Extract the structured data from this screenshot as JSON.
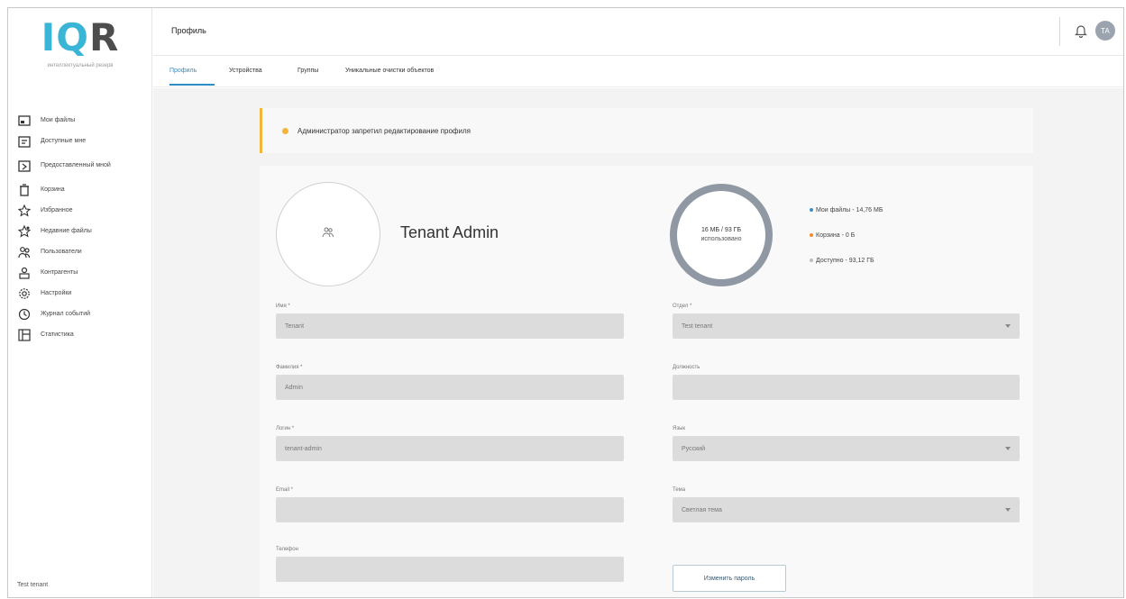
{
  "logo": {
    "letters_accent": "IQ",
    "letters_dark": "R",
    "subtitle": "интеллектуальный резерв"
  },
  "sidebar": {
    "items": [
      {
        "label": "Мои файлы",
        "icon": "folder-icon"
      },
      {
        "label": "Доступные мне",
        "icon": "shared-folder-icon"
      },
      {
        "label": "Предоставленный мной",
        "icon": "provided-folder-icon"
      },
      {
        "label": "Корзина",
        "icon": "trash-icon"
      },
      {
        "label": "Избранное",
        "icon": "star-icon"
      },
      {
        "label": "Недавние файлы",
        "icon": "recent-star-icon"
      },
      {
        "label": "Пользователи",
        "icon": "users-icon"
      },
      {
        "label": "Контрагенты",
        "icon": "contractors-icon"
      },
      {
        "label": "Настройки",
        "icon": "gear-icon"
      },
      {
        "label": "Журнал событий",
        "icon": "clock-icon"
      },
      {
        "label": "Статистика",
        "icon": "statistics-icon"
      }
    ],
    "footer": "Test tenant"
  },
  "header": {
    "title": "Профиль",
    "avatar_initials": "TA"
  },
  "tabs": [
    {
      "label": "Профиль",
      "active": true
    },
    {
      "label": "Устройства",
      "active": false
    },
    {
      "label": "Группы",
      "active": false
    },
    {
      "label": "Уникальные очистки объектов",
      "active": false
    }
  ],
  "notice": {
    "text": "Администратор запретил редактирование профиля",
    "color": "#f4b63a"
  },
  "profile": {
    "name": "Tenant Admin"
  },
  "storage": {
    "used": "16 МБ / 93 ГБ",
    "caption": "использовано",
    "legend": [
      {
        "label": "Мои файлы - 14,76 МБ",
        "color": "#3b8fc7"
      },
      {
        "label": "Корзина - 0 Б",
        "color": "#f08a2a"
      },
      {
        "label": "Доступно - 93,12 ГБ",
        "color": "#b8bec4"
      }
    ]
  },
  "form": {
    "first_name": {
      "label": "Имя *",
      "value": "Tenant"
    },
    "last_name": {
      "label": "Фамилия *",
      "value": "Admin"
    },
    "login": {
      "label": "Логин *",
      "value": "tenant-admin"
    },
    "email": {
      "label": "Email *",
      "value": ""
    },
    "phone": {
      "label": "Телефон",
      "value": ""
    },
    "department": {
      "label": "Отдел *",
      "value": "Test tenant"
    },
    "position": {
      "label": "Должность",
      "value": ""
    },
    "language": {
      "label": "Язык",
      "value": "Русский"
    },
    "theme": {
      "label": "Тема",
      "value": "Светлая тема"
    },
    "change_password": "Изменить пароль"
  }
}
